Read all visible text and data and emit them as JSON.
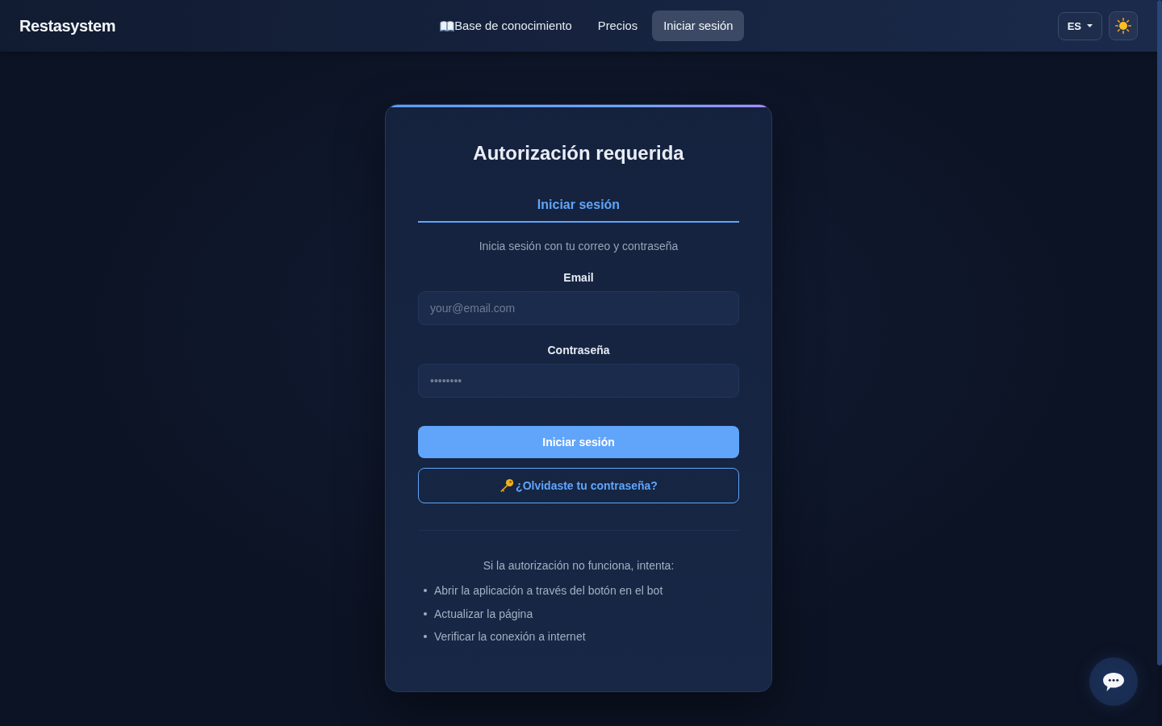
{
  "header": {
    "logo": "Restasystem",
    "nav": [
      {
        "label": "Base de conocimiento",
        "kind": "iconed",
        "selected": false
      },
      {
        "label": "Precios",
        "kind": "plain",
        "selected": false
      },
      {
        "label": "Iniciar sesión",
        "kind": "plain",
        "selected": true
      }
    ],
    "language": {
      "label": "ES"
    }
  },
  "login_card": {
    "title": "Autorización requerida",
    "tabs": [
      {
        "label": "Iniciar sesión",
        "selected": true
      }
    ],
    "subtitle": "Inicia sesión con tu correo y contraseña",
    "fields": [
      {
        "label": "Email",
        "placeholder": "your@email.com"
      },
      {
        "label": "Contraseña",
        "placeholder": "••••••••"
      }
    ],
    "buttons": [
      {
        "kind": "primary",
        "label": "Iniciar sesión"
      },
      {
        "kind": "outline",
        "label": "¿Olvidaste tu contraseña?"
      }
    ],
    "help": {
      "intro": "Si la autorización no funciona, intenta:",
      "items": [
        "Abrir la aplicación a través del botón en el bot",
        "Actualizar la página",
        "Verificar la conexión a internet"
      ]
    }
  }
}
